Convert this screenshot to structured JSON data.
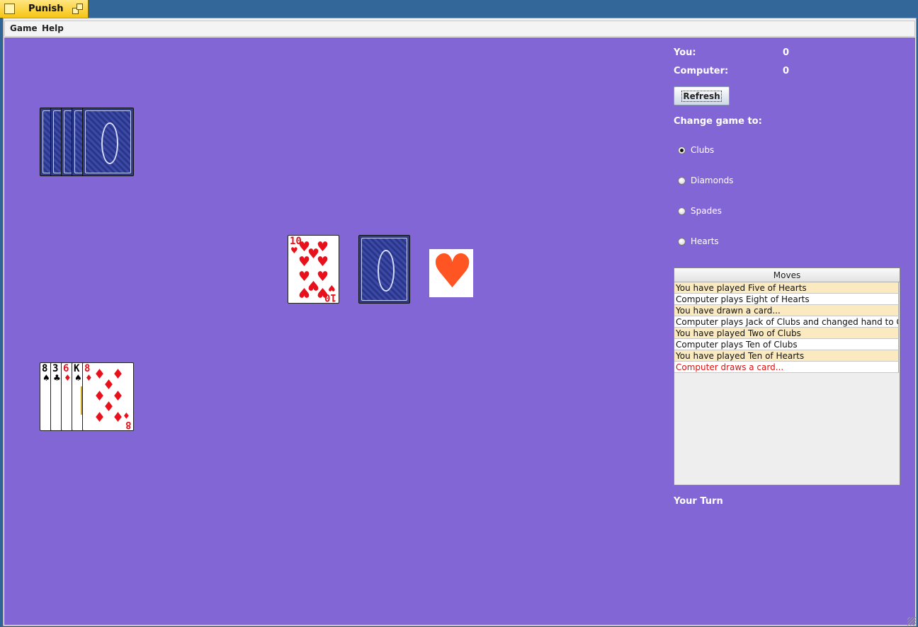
{
  "window": {
    "title": "Punish"
  },
  "menu": {
    "game": "Game",
    "help": "Help"
  },
  "score": {
    "you_label": "You:",
    "you_value": "0",
    "computer_label": "Computer:",
    "computer_value": "0"
  },
  "refresh_label": "Refresh",
  "change_game_label": "Change game to:",
  "suits": [
    {
      "label": "Clubs",
      "checked": true
    },
    {
      "label": "Diamonds",
      "checked": false
    },
    {
      "label": "Spades",
      "checked": false
    },
    {
      "label": "Hearts",
      "checked": false
    }
  ],
  "moves": {
    "header": "Moves",
    "rows": [
      "You have played Five of Hearts",
      "Computer plays Eight of Hearts",
      "You have drawn a card...",
      "Computer plays Jack of Clubs and changed hand to Clubs",
      "You have played Two of Clubs",
      "Computer plays Ten of Clubs",
      "You have played Ten of Hearts",
      "Computer draws a card..."
    ]
  },
  "status": "Your Turn",
  "computer_hand_count": 5,
  "player_hand": [
    {
      "rank": "8",
      "suit": "♠",
      "color": "black"
    },
    {
      "rank": "3",
      "suit": "♣",
      "color": "black"
    },
    {
      "rank": "6",
      "suit": "♦",
      "color": "red"
    },
    {
      "rank": "K",
      "suit": "♠",
      "color": "black"
    },
    {
      "rank": "8",
      "suit": "♦",
      "color": "red"
    }
  ],
  "discard_top": {
    "rank": "10",
    "suit": "♥",
    "color": "red"
  },
  "current_suit": {
    "symbol": "♥",
    "color": "#ff5522"
  },
  "colors": {
    "table": "#8366d6",
    "title_tab": "#f6c514",
    "row_highlight": "#fbeac0",
    "last_move": "#e01010"
  }
}
